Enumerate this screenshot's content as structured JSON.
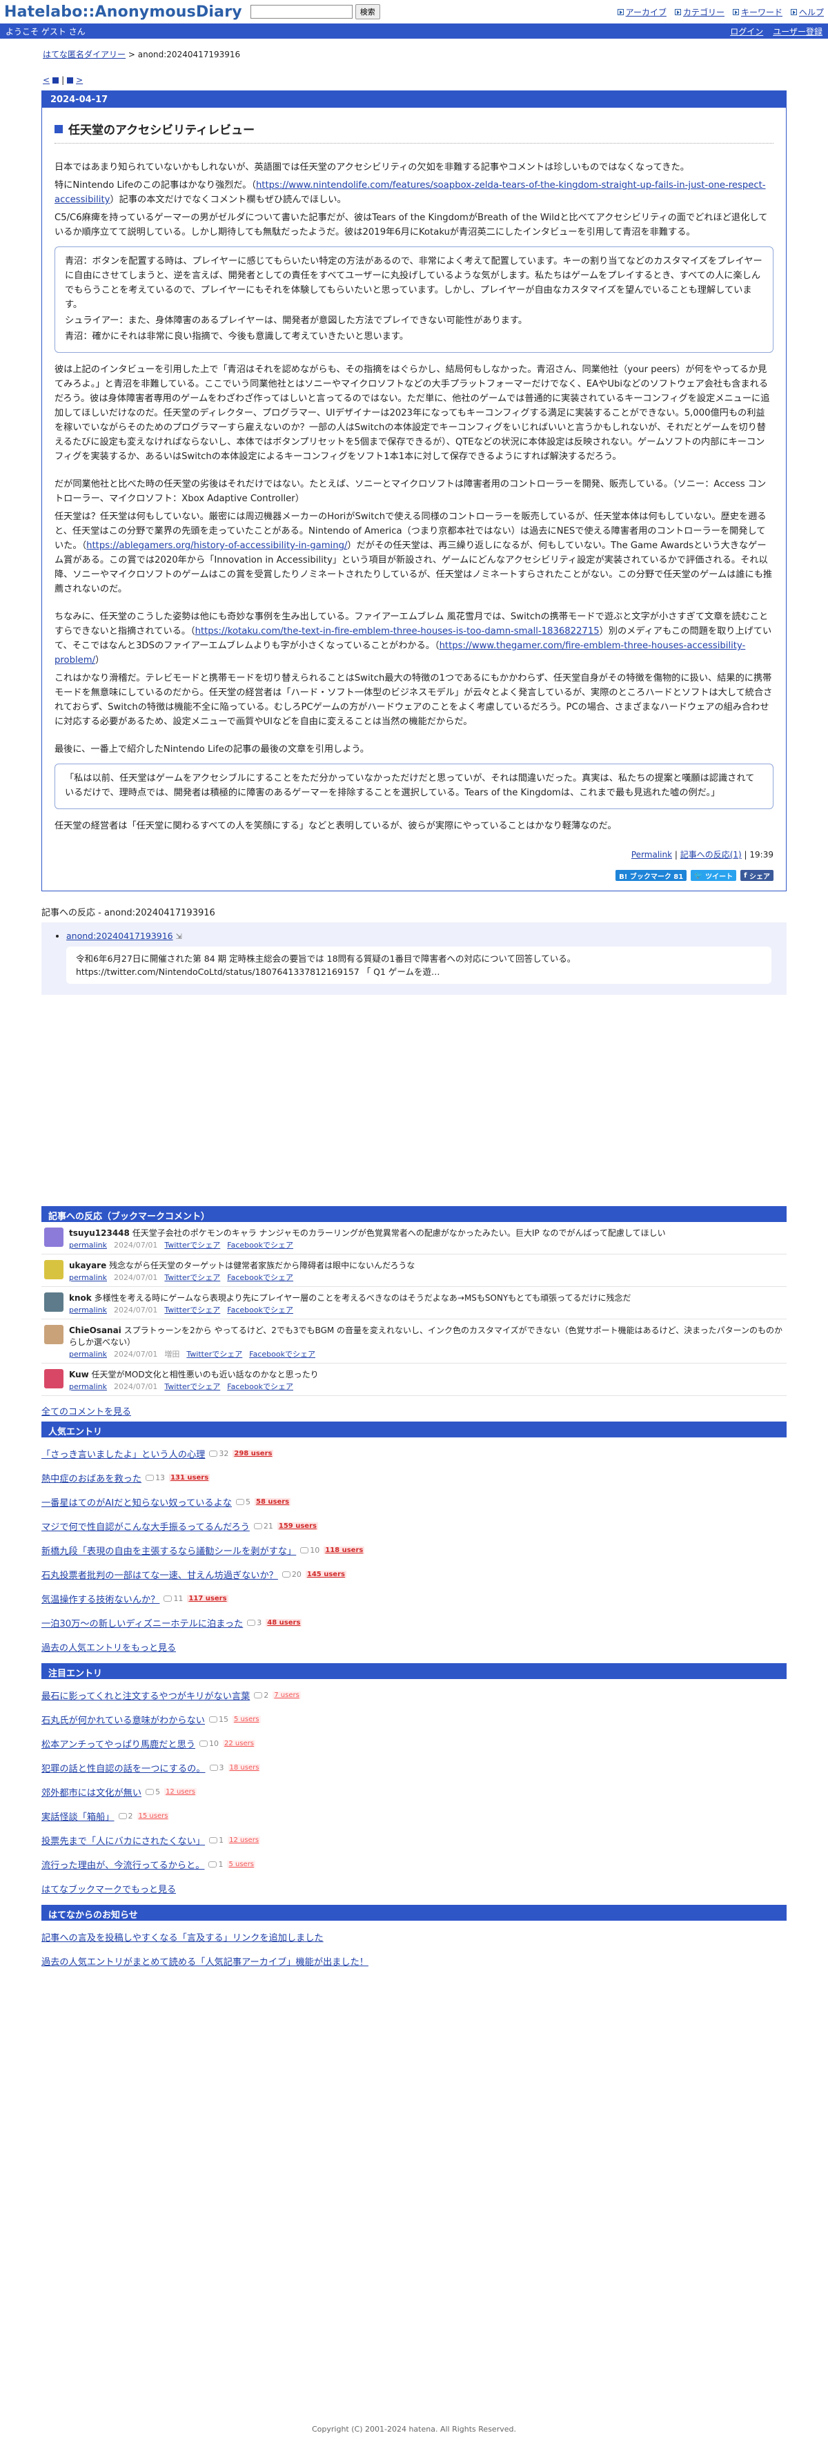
{
  "header": {
    "logo": "Hatelabo::AnonymousDiary",
    "search_placeholder": "",
    "search_button": "検索",
    "nav": [
      "アーカイブ",
      "カテゴリー",
      "キーワード",
      "ヘルプ"
    ]
  },
  "subbar": {
    "welcome": "ようこそ ゲスト さん",
    "login": "ログイン",
    "register": "ユーザー登録"
  },
  "breadcrumb": {
    "home": "はてな匿名ダイアリー",
    "sep": ">",
    "current": "anond:20240417193916"
  },
  "pager": {
    "prev": "<",
    "next": ">"
  },
  "entry": {
    "date": "2024-04-17",
    "title": "任天堂のアクセシビリティレビュー",
    "p1": "日本ではあまり知られていないかもしれないが、英語圏では任天堂のアクセシビリティの欠如を非難する記事やコメントは珍しいものではなくなってきた。",
    "p2a": "特にNintendo Lifeのこの記事はかなり強烈だ。（",
    "p2link": "https://www.nintendolife.com/features/soapbox-zelda-tears-of-the-kingdom-straight-up-fails-in-just-one-respect-accessibility",
    "p2b": "）記事の本文だけでなくコメント欄もぜひ読んでほしい。",
    "p3": "C5/C6麻痺を持っているゲーマーの男がゼルダについて書いた記事だが、彼はTears of the KingdomがBreath of the Wildと比べてアクセシビリティの面でどれほど退化しているか順序立てて説明している。しかし期待しても無駄だったようだ。彼は2019年6月にKotakuが青沼英二にしたインタビューを引用して青沼を非難する。",
    "quote1": [
      "青沼：ボタンを配置する時は、プレイヤーに感じてもらいたい特定の方法があるので、非常によく考えて配置しています。キーの割り当てなどのカスタマイズをプレイヤーに自由にさせてしまうと、逆を言えば、開発者としての責任をすべてユーザーに丸投げしているような気がします。私たちはゲームをプレイするとき、すべての人に楽しんでもらうことを考えているので、プレイヤーにもそれを体験してもらいたいと思っています。しかし、プレイヤーが自由なカスタマイズを望んでいることも理解しています。",
      "シュライアー：また、身体障害のあるプレイヤーは、開発者が意図した方法でプレイできない可能性があります。",
      "青沼：確かにそれは非常に良い指摘で、今後も意識して考えていきたいと思います。"
    ],
    "p4": "彼は上記のインタビューを引用した上で「青沼はそれを認めながらも、その指摘をはぐらかし、結局何もしなかった。青沼さん、同業他社（your peers）が何をやってるか見てみろよ。」と青沼を非難している。ここでいう同業他社とはソニーやマイクロソフトなどの大手プラットフォーマーだけでなく、EAやUbiなどのソフトウェア会社も含まれるだろう。彼は身体障害者専用のゲームをわざわざ作ってはしいと言ってるのではない。ただ単に、他社のゲームでは普通的に実装されているキーコンフィグを設定メニューに追加してほしいだけなのだ。任天堂のディレクター、プログラマー、UIデザイナーは2023年になってもキーコンフィグする満足に実装することができない。5,000億円もの利益を稼いでいながらそのためのプログラマーすら雇えないのか？一部の人はSwitchの本体設定でキーコンフィグをいじればいいと言うかもしれないが、それだとゲームを切り替えるたびに設定も変えなければならないし、本体ではボタンプリセットを5個まで保存できるが）、QTEなどの状況に本体設定は反映されない。ゲームソフトの内部にキーコンフィグを実装するか、あるいはSwitchの本体設定によるキーコンフィグをソフト1本1本に対して保存できるようにすれば解決するだろう。",
    "p5": "だが同業他社と比べた時の任天堂の劣後はそれだけではない。たとえば、ソニーとマイクロソフトは障害者用のコントローラーを開発、販売している。（ソニー：Access コントローラー、マイクロソフト：Xbox Adaptive Controller）",
    "p6a": "任天堂は？任天堂は何もしていない。厳密には周辺機器メーカーのHoriがSwitchで使える同様のコントローラーを販売しているが、任天堂本体は何もしていない。歴史を遡ると、任天堂はこの分野で業界の先頭を走っていたことがある。Nintendo of America（つまり京都本社ではない）は過去にNESで使える障害者用のコントローラーを開発していた。（",
    "p6link": "https://ablegamers.org/history-of-accessibility-in-gaming/",
    "p6b": "）だがその任天堂は、再三繰り返しになるが、何もしていない。The Game Awardsという大きなゲーム賞がある。この賞では2020年から「Innovation in Accessibility」という項目が新設され、ゲームにどんなアクセシビリティ設定が実装されているかで評価される。それ以降、ソニーやマイクロソフトのゲームはこの賞を受賞したりノミネートされたりしているが、任天堂はノミネートすらされたことがない。この分野で任天堂のゲームは誰にも推薦されないのだ。",
    "p7a": "ちなみに、任天堂のこうした姿勢は他にも奇妙な事例を生み出している。ファイアーエムブレム 風花雪月では、Switchの携帯モードで遊ぶと文字が小さすぎて文章を読むことすらできないと指摘されている。（",
    "p7link1": "https://kotaku.com/the-text-in-fire-emblem-three-houses-is-too-damn-small-1836822715",
    "p7b": "）別のメディアもこの問題を取り上げていて、そこではなんと3DSのファイアーエムブレムよりも字が小さくなっていることがわかる。（",
    "p7link2": "https://www.thegamer.com/fire-emblem-three-houses-accessibility-problem/",
    "p7c": "）",
    "p8": "これはかなり滑稽だ。テレビモードと携帯モードを切り替えられることはSwitch最大の特徴の1つであるにもかかわらず、任天堂自身がその特徴を傷物的に扱い、結果的に携帯モードを無意味にしているのだから。任天堂の経営者は「ハード・ソフト一体型のビジネスモデル」が云々とよく発言しているが、実際のところハードとソフトは大して統合されておらず、Switchの特徴は機能不全に陥っている。むしろPCゲームの方がハードウェアのことをよく考慮しているだろう。PCの場合、さまざまなハードウェアの組み合わせに対応する必要があるため、設定メニューで画質やUIなどを自由に変えることは当然の機能だからだ。",
    "p9": "最後に、一番上で紹介したNintendo Lifeの記事の最後の文章を引用しよう。",
    "quote2": "「私は以前、任天堂はゲームをアクセシブルにすることをただ分かっていなかっただけだと思っていが、それは間違いだった。真実は、私たちの提案と嘆願は認識されているだけで、理時点では、開発者は積極的に障害のあるゲーマーを排除することを選択している。Tears of the Kingdomは、これまで最も見逃れた嘘の例だ。」",
    "p10": "任天堂の経営者は「任天堂に関わるすべての人を笑顔にする」などと表明しているが、彼らが実際にやっていることはかなり軽薄なのだ。",
    "permalink": "Permalink",
    "reactions_link": "記事への反応(1)",
    "time": "19:39",
    "bookmark_btn": "B! ブックマーク 81",
    "tweet_btn": "ツイート",
    "share_btn": "シェア"
  },
  "references": {
    "heading": "記事への反応 - anond:20240417193916",
    "item_link": "anond:20240417193916",
    "item_icon": "link-icon",
    "item_quote": "令和6年6月27日に開催された第 84 期 定時株主総会の要旨では 18問有る質疑の1番目で障害者への対応について回答している。 https://twitter.com/NintendoCoLtd/status/1807641337812169157 「 Q1 ゲームを遊…"
  },
  "bookmarks": {
    "heading": "記事への反応（ブックマークコメント）",
    "items": [
      {
        "user": "tsuyu123448",
        "comment": "任天堂子会社のポケモンのキャラ ナンジャモのカラーリングが色覚異常者への配慮がなかったみたい。巨大IP なのでがんばって配慮してほしい",
        "permalink": "permalink",
        "date": "2024/07/01",
        "tw": "Twitterでシェア",
        "fb": "Facebookでシェア",
        "color": "#8c7bd9"
      },
      {
        "user": "ukayare",
        "comment": "残念ながら任天堂のターゲットは健常者家族だから障碍者は眼中にないんだろうな",
        "permalink": "permalink",
        "date": "2024/07/01",
        "tw": "Twitterでシェア",
        "fb": "Facebookでシェア",
        "color": "#d8c341"
      },
      {
        "user": "knok",
        "comment": "多様性を考える時にゲームなら表現より先にプレイヤー層のことを考えるべきなのはそうだよなあ→MSもSONYもとても頑張ってるだけに残念だ",
        "permalink": "permalink",
        "date": "2024/07/01",
        "tw": "Twitterでシェア",
        "fb": "Facebookでシェア",
        "color": "#5d7b8a"
      },
      {
        "user": "ChieOsanai",
        "comment": "スプラトゥーンを2から やってるけど、2でも3でもBGM の音量を変えれないし、インク色のカスタマイズができない（色覚サポート機能はあるけど、決まったパターンのものからしか選べない）",
        "permalink": "permalink",
        "date": "2024/07/01",
        "tw": "Twitterでシェア",
        "fb": "Facebookでシェア",
        "color": "#c9a27a",
        "tag": "増田"
      },
      {
        "user": "Kuw",
        "comment": "任天堂がMOD文化と相性悪いのも近い話なのかなと思ったり",
        "permalink": "permalink",
        "date": "2024/07/01",
        "tw": "Twitterでシェア",
        "fb": "Facebookでシェア",
        "color": "#d84866"
      }
    ],
    "all_link": "全てのコメントを見る"
  },
  "popular": {
    "heading": "人気エントリ",
    "items": [
      {
        "title": "「さっき言いましたよ」という人の心理",
        "count": "32",
        "users": "298 users"
      },
      {
        "title": "熱中症のおばあを救った",
        "count": "13",
        "users": "131 users"
      },
      {
        "title": "一番星はてのがAIだと知らない奴っているよな",
        "count": "5",
        "users": "58 users"
      },
      {
        "title": "マジで何で性自認がこんな大手振るってるんだろう",
        "count": "21",
        "users": "159 users"
      },
      {
        "title": "新橋九段「表現の自由を主張するなら議勧シールを剥がすな」",
        "count": "10",
        "users": "118 users"
      },
      {
        "title": "石丸投票者批判の一部はてな一速、甘えん坊過ぎないか？",
        "count": "20",
        "users": "145 users"
      },
      {
        "title": "気温操作する技術ないんか？",
        "count": "11",
        "users": "117 users"
      },
      {
        "title": "一泊30万〜の新しいディズニーホテルに泊まった",
        "count": "3",
        "users": "48 users"
      }
    ],
    "more": "過去の人気エントリをもっと見る"
  },
  "hot": {
    "heading": "注目エントリ",
    "items": [
      {
        "title": "最石に影ってくれと注文するやつがキリがない言葉",
        "count": "2",
        "users": "7 users"
      },
      {
        "title": "石丸氏が何かれている意味がわからない",
        "count": "15",
        "users": "5 users"
      },
      {
        "title": "松本アンチってやっぱり馬鹿だと思う",
        "count": "10",
        "users": "22 users"
      },
      {
        "title": "犯罪の話と性自認の話を一つにするの。",
        "count": "3",
        "users": "18 users"
      },
      {
        "title": "郊外都市には文化が無い",
        "count": "5",
        "users": "12 users"
      },
      {
        "title": "実話怪談「箱船」",
        "count": "2",
        "users": "15 users"
      },
      {
        "title": "投票先まで「人にバカにされたくない」",
        "count": "1",
        "users": "12 users"
      },
      {
        "title": "流行った理由が、今流行ってるからと。",
        "count": "1",
        "users": "5 users"
      }
    ],
    "more": "はてなブックマークでもっと見る"
  },
  "news": {
    "heading": "はてなからのお知らせ",
    "items": [
      "記事への言及を投稿しやすくなる「言及する」リンクを追加しました",
      "過去の人気エントリがまとめて読める「人気記事アーカイブ」機能が出ました！"
    ]
  },
  "footer": {
    "copyright": "Copyright (C) 2001-2024 hatena. All Rights Reserved."
  }
}
